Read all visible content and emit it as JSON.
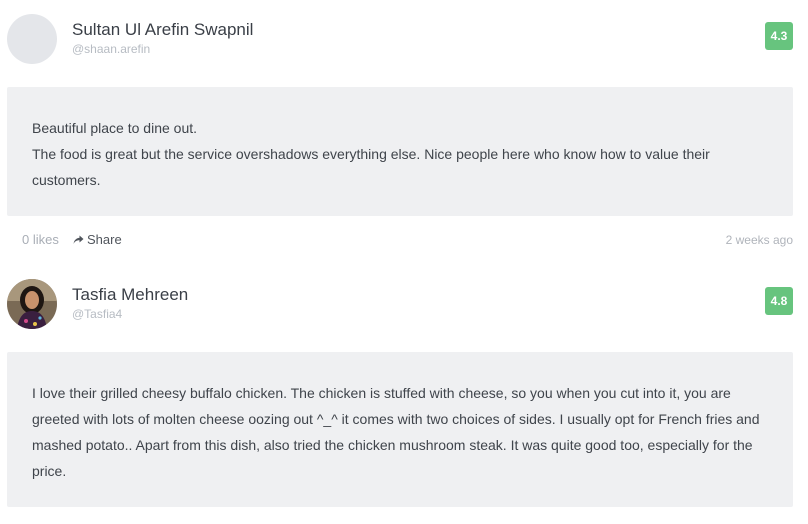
{
  "reviews": [
    {
      "name": "Sultan Ul Arefin Swapnil",
      "handle": "@shaan.arefin",
      "rating": "4.3",
      "body_lines": [
        "Beautiful place to dine out.",
        "The food is great but the service overshadows everything else. Nice people here who know how to value their customers."
      ],
      "likes": "0 likes",
      "share_label": "Share",
      "time": "2 weeks ago",
      "avatar": "placeholder",
      "rating_color": "#67c47e"
    },
    {
      "name": "Tasfia Mehreen",
      "handle": "@Tasfia4",
      "rating": "4.8",
      "body_lines": [
        "I love their grilled cheesy buffalo chicken. The chicken is stuffed with cheese, so you when you cut into it, you are greeted with lots of molten cheese oozing out ^_^ it comes with two choices of sides. I usually opt for French fries and mashed potato.. Apart from this dish, also tried the chicken mushroom steak. It was quite good too, especially for the price."
      ],
      "avatar": "photo",
      "rating_color": "#67c47e"
    }
  ],
  "icons": {
    "share": "share-arrow-icon"
  }
}
